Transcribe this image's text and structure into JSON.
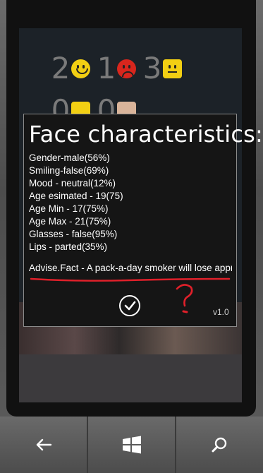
{
  "scoreboard": {
    "row1": [
      {
        "number": "2",
        "face": "happy"
      },
      {
        "number": "1",
        "face": "sad"
      },
      {
        "number": "3",
        "face": "neutral"
      }
    ],
    "row2": [
      {
        "number": "0",
        "face": "photo"
      },
      {
        "number": "0",
        "face": "photo"
      }
    ]
  },
  "dialog": {
    "title": "Face characteristics:",
    "lines": [
      "Gender-male(56%)",
      "Smiling-false(69%)",
      "Mood - neutral(12%)",
      "Age esimated - 19(75)",
      "Age Min - 17(75%)",
      "Age Max - 21(75%)",
      "Glasses - false(95%)",
      "Lips - parted(35%)"
    ],
    "advice": "Advise.Fact - A pack-a-day smoker will lose approximately",
    "version": "v1.0"
  },
  "nav": {
    "back_icon": "back-arrow-icon",
    "start_icon": "windows-logo-icon",
    "search_icon": "search-icon"
  },
  "colors": {
    "annotation_red": "#e0202a",
    "smiley_yellow": "#f2cf13",
    "smiley_red": "#d8261d"
  }
}
